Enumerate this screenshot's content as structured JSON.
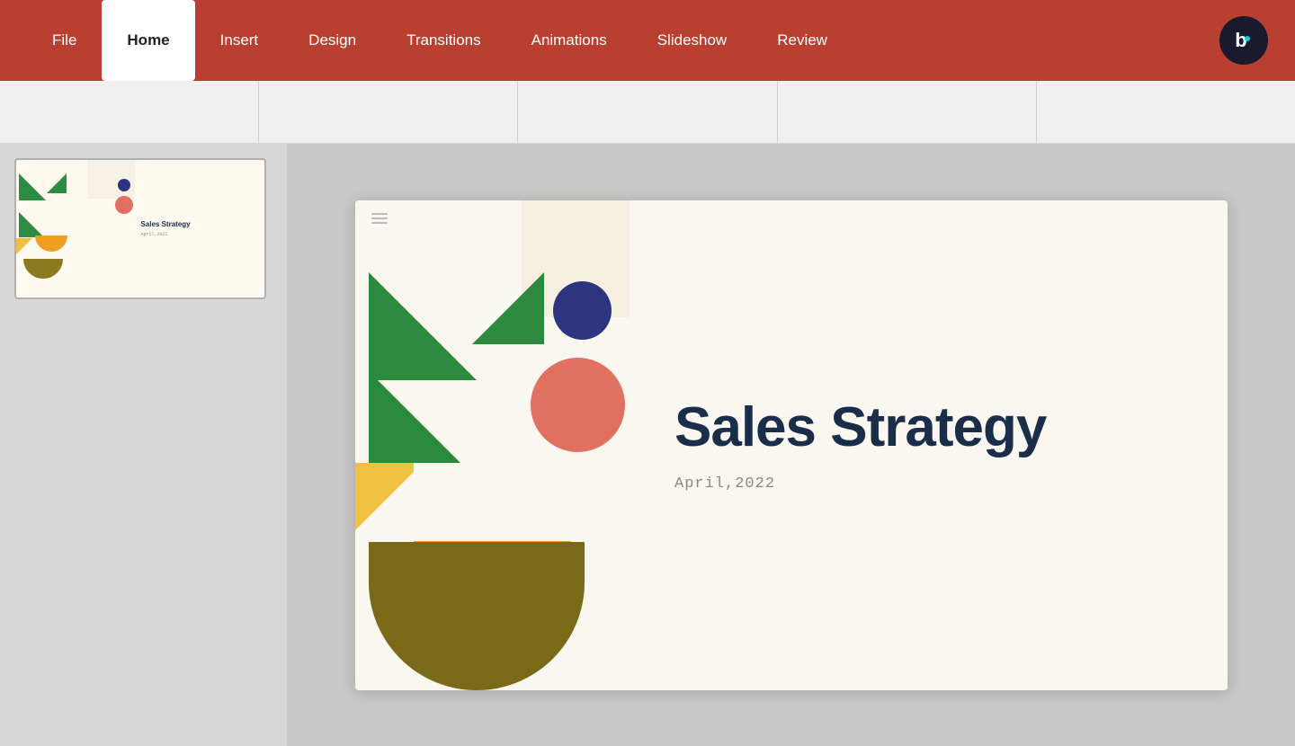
{
  "menu": {
    "items": [
      {
        "label": "File",
        "active": false
      },
      {
        "label": "Home",
        "active": true
      },
      {
        "label": "Insert",
        "active": false
      },
      {
        "label": "Design",
        "active": false
      },
      {
        "label": "Transitions",
        "active": false
      },
      {
        "label": "Animations",
        "active": false
      },
      {
        "label": "Slideshow",
        "active": false
      },
      {
        "label": "Review",
        "active": false
      }
    ]
  },
  "logo": {
    "letter": "b"
  },
  "slide": {
    "title": "Sales Strategy",
    "date": "April,2022"
  }
}
